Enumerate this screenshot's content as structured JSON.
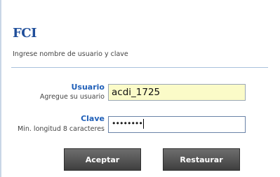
{
  "header": {
    "logo_text": "FCI",
    "subtitle": "Ingrese nombre de usuario y clave"
  },
  "form": {
    "username": {
      "label": "Usuario",
      "hint": "Agregue su usuario",
      "value": "acdi_1725"
    },
    "password": {
      "label": "Clave",
      "hint": "Min. longitud 8 caracteres",
      "masked_value": "••••••••"
    }
  },
  "buttons": {
    "accept_label": "Aceptar",
    "reset_label": "Restaurar"
  },
  "colors": {
    "brand": "#1f4e9a",
    "label_blue": "#1f5fb8",
    "username_field_bg": "#fbfbc8",
    "button_bg": "#4f4f4f"
  }
}
